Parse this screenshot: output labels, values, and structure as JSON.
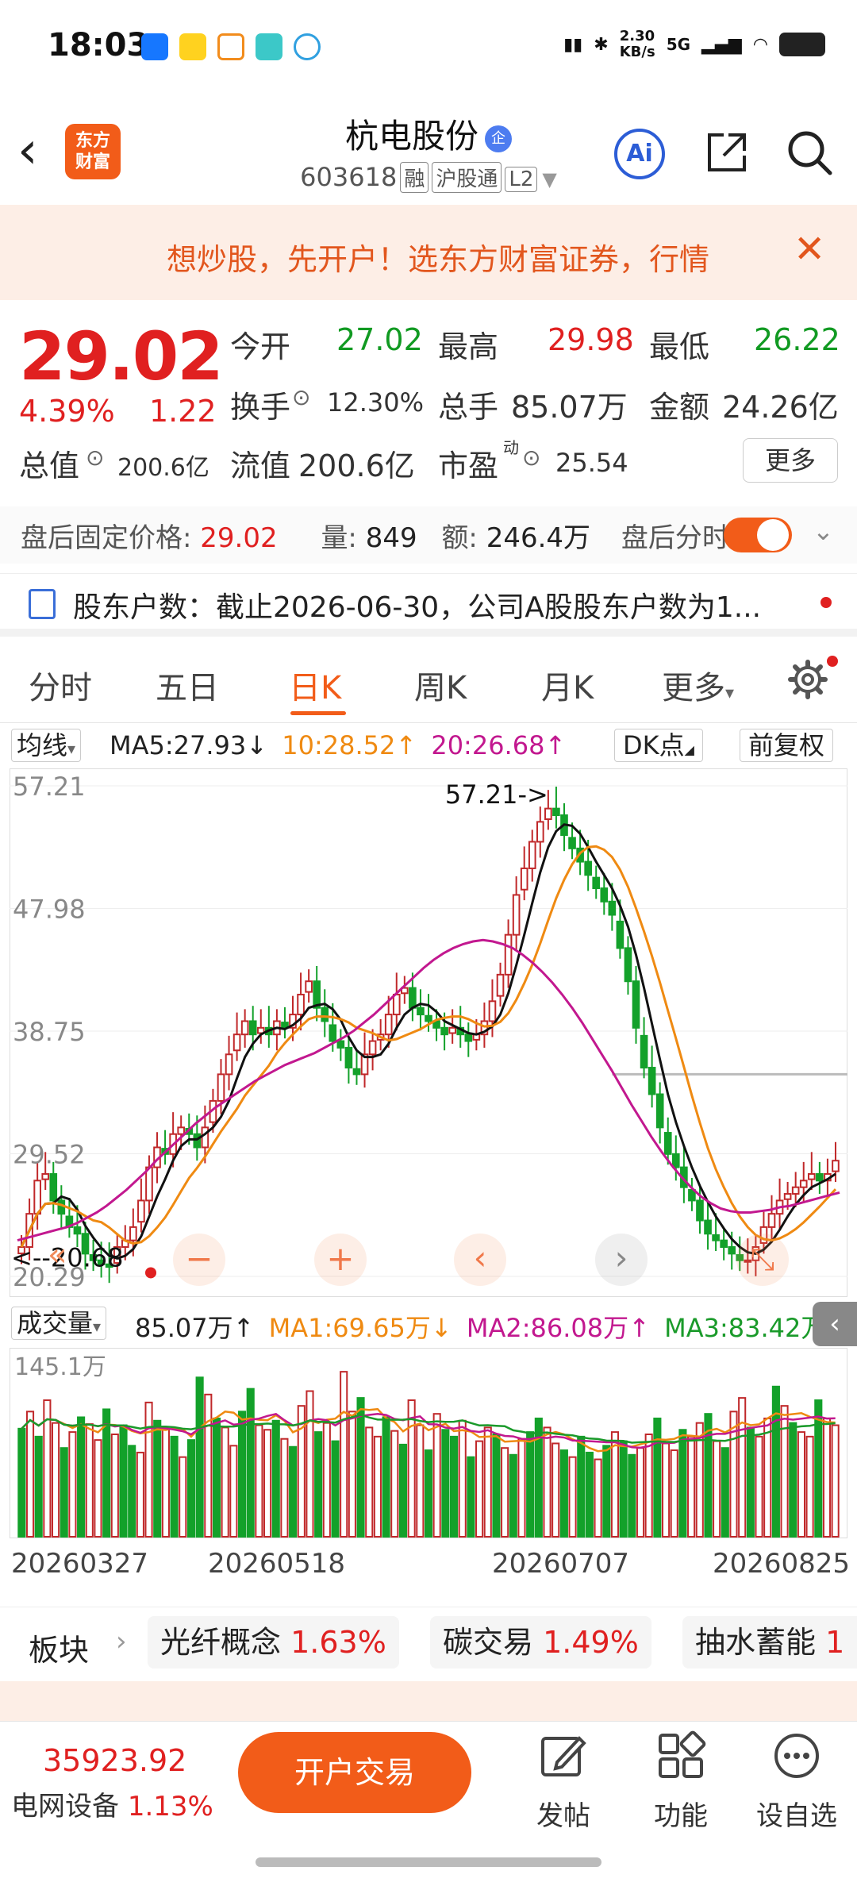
{
  "status_bar": {
    "time": "18:03",
    "app_icons": [
      "alipay-icon",
      "meituan-icon",
      "didi-icon",
      "notes-icon",
      "cloud-icon"
    ],
    "speed_top": "2.30",
    "speed_unit": "KB/s",
    "network": "5G"
  },
  "header": {
    "logo_line1": "东方",
    "logo_line2": "财富",
    "stock_name": "杭电股份",
    "badge": "企",
    "stock_code": "603618",
    "tags": [
      "融",
      "沪股通",
      "L2"
    ],
    "ai_label": "Ai"
  },
  "banner": {
    "text": "想炒股，先开户！选东方财富证券，行情",
    "close": "✕"
  },
  "quote": {
    "price": "29.02",
    "pct": "4.39%",
    "change": "1.22",
    "fields": [
      {
        "label": "今开",
        "value": "27.02",
        "color": "#119a22"
      },
      {
        "label": "最高",
        "value": "29.98",
        "color": "#e02020"
      },
      {
        "label": "最低",
        "value": "26.22",
        "color": "#119a22"
      },
      {
        "label": "换手",
        "value": "12.30%",
        "color": "#333333"
      },
      {
        "label": "总手",
        "value": "85.07万",
        "color": "#333333"
      },
      {
        "label": "金额",
        "value": "24.26亿",
        "color": "#333333"
      },
      {
        "label": "总值",
        "value": "200.6亿",
        "color": "#333333"
      },
      {
        "label": "流值",
        "value": "200.6亿",
        "color": "#333333"
      },
      {
        "label": "市盈",
        "sup": "动",
        "value": "25.54",
        "color": "#333333"
      }
    ],
    "more": "更多"
  },
  "after_hours": {
    "price_label": "盘后固定价格:",
    "price": "29.02",
    "vol_label": "量:",
    "vol": "849",
    "amt_label": "额:",
    "amt": "246.4万",
    "toggle_label": "盘后分时"
  },
  "holders": {
    "text": "股东户数：截止2026-06-30，公司A股股东户数为1..."
  },
  "tabs": [
    "分时",
    "五日",
    "日K",
    "周K",
    "月K",
    "更多"
  ],
  "active_tab": "日K",
  "ma_row": {
    "select": "均线",
    "ma5": "MA5:27.93",
    "ma5_arrow": "↓",
    "ma10": "10:28.52",
    "ma10_arrow": "↑",
    "ma20": "20:26.68",
    "ma20_arrow": "↑",
    "dk": "DK点",
    "fq": "前复权"
  },
  "chart_data": {
    "type": "candlestick",
    "y_ticks": [
      "57.21",
      "47.98",
      "38.75",
      "29.52",
      "20.29"
    ],
    "ylim": [
      20.29,
      57.21
    ],
    "high_annotation": "57.21->",
    "low_annotation": "<--20.68",
    "colors": {
      "up": "#c0282a",
      "down": "#13a12a",
      "ma5": "#111111",
      "ma10": "#ef8a12",
      "ma20": "#c2188f"
    },
    "closes": [
      22.5,
      25,
      27.5,
      28,
      26,
      25,
      24,
      23.5,
      22,
      21.5,
      21.2,
      21,
      22.5,
      23,
      24,
      26,
      28.5,
      30,
      29.5,
      31,
      31.5,
      31,
      30,
      31.5,
      33.5,
      35.5,
      37,
      38.5,
      39.5,
      38.5,
      39,
      38.5,
      39.5,
      39,
      40,
      41.5,
      42.5,
      40.5,
      39.5,
      38,
      37.5,
      36,
      35.5,
      37,
      38,
      38.5,
      40,
      41.5,
      42,
      40.5,
      40,
      39.5,
      39,
      38.5,
      39,
      38.5,
      38,
      38.5,
      39.5,
      41,
      43,
      46,
      49,
      51,
      53,
      54.5,
      55.5,
      55,
      53.5,
      52.5,
      51.5,
      50.5,
      49.5,
      48.5,
      47.5,
      45,
      42.5,
      39,
      36,
      34,
      31.5,
      29.5,
      28.5,
      27,
      26,
      24.5,
      23.5,
      23,
      22.5,
      22,
      21.5,
      21.5,
      22.5,
      24,
      25,
      26,
      26.5,
      27,
      27.5,
      28,
      27.5,
      28,
      29
    ],
    "ma20_values": [
      23,
      23.2,
      23.4,
      23.6,
      23.8,
      24,
      24.3,
      24.7,
      25.1,
      25.6,
      26.2,
      26.8,
      27.5,
      28.2,
      29,
      29.7,
      30.4,
      31.1,
      31.8,
      32.4,
      33,
      33.5,
      34,
      34.5,
      35,
      35.4,
      35.8,
      36.2,
      36.5,
      36.8,
      37.1,
      37.5,
      37.9,
      38.3,
      38.8,
      39.4,
      40,
      40.7,
      41.4,
      42.1,
      42.8,
      43.5,
      44.1,
      44.6,
      45,
      45.3,
      45.5,
      45.6,
      45.5,
      45.3,
      45,
      44.5,
      43.9,
      43.2,
      42.4,
      41.5,
      40.5,
      39.4,
      38.2,
      37,
      35.8,
      34.5,
      33.2,
      32,
      30.8,
      29.7,
      28.7,
      27.8,
      27,
      26.3,
      25.8,
      25.4,
      25.2,
      25.1,
      25.1,
      25.2,
      25.3,
      25.5,
      25.6,
      25.8,
      26,
      26.2,
      26.4,
      26.6
    ],
    "cutoff_line": 35.5
  },
  "volume_row": {
    "select": "成交量",
    "vol": "85.07万",
    "vol_arrow": "↑",
    "ma1": "MA1:69.65万",
    "ma1_arrow": "↓",
    "ma2": "MA2:86.08万",
    "ma2_arrow": "↑",
    "ma3": "MA3:83.42万",
    "ma3_arrow": "↑",
    "y_max": "145.1万",
    "collapse": "‹"
  },
  "volume_data": {
    "max": 145.1,
    "values": [
      95,
      110,
      88,
      120,
      100,
      78,
      92,
      105,
      99,
      85,
      112,
      90,
      98,
      80,
      74,
      118,
      102,
      95,
      88,
      70,
      85,
      140,
      125,
      104,
      96,
      80,
      110,
      130,
      98,
      94,
      102,
      86,
      79,
      115,
      128,
      92,
      100,
      84,
      145,
      110,
      122,
      96,
      88,
      105,
      93,
      81,
      120,
      98,
      76,
      108,
      94,
      88,
      102,
      70,
      84,
      96,
      90,
      78,
      72,
      86,
      92,
      104,
      96,
      82,
      76,
      70,
      88,
      74,
      68,
      80,
      92,
      84,
      72,
      78,
      90,
      104,
      82,
      76,
      94,
      88,
      100,
      108,
      84,
      78,
      110,
      122,
      96,
      88,
      104,
      132,
      115,
      100,
      92,
      88,
      120,
      104,
      98
    ],
    "ups_pattern": [
      0,
      1,
      0,
      1,
      1,
      0,
      1,
      0,
      1,
      1,
      0,
      1,
      0,
      0,
      1,
      1,
      0,
      1,
      0,
      1,
      0,
      0,
      1,
      0,
      1,
      1,
      0,
      0,
      1,
      1,
      0,
      1,
      0,
      1,
      1,
      0,
      1,
      0,
      1,
      1,
      0,
      1,
      1,
      0,
      1,
      0,
      1,
      1,
      0,
      1,
      0,
      0,
      1,
      0,
      1,
      1,
      0,
      1,
      0,
      1,
      0,
      0,
      1,
      1,
      0,
      1,
      0,
      0,
      1,
      0,
      1,
      0,
      0,
      1,
      1,
      0,
      1,
      1,
      0,
      1,
      1,
      0,
      1,
      0,
      1,
      1,
      0,
      1,
      1,
      0,
      1,
      0,
      1,
      1,
      0,
      1,
      1
    ],
    "ma_colors": [
      "#ef8a12",
      "#c2188f",
      "#1a9a2a"
    ]
  },
  "dates": [
    "20260327",
    "20260518",
    "20260707",
    "20260825"
  ],
  "chart_controls": [
    "«",
    "−",
    "+",
    "‹",
    "›",
    "⤡"
  ],
  "sectors": {
    "label": "板块",
    "items": [
      {
        "name": "光纤概念",
        "pct": "1.63%"
      },
      {
        "name": "碳交易",
        "pct": "1.49%"
      },
      {
        "name": "抽水蓄能",
        "pct": "1"
      }
    ]
  },
  "bottom": {
    "index_value": "35923.92",
    "index_name": "电网设备",
    "index_pct": "1.13%",
    "open_button": "开户交易",
    "actions": [
      "发帖",
      "功能",
      "设自选"
    ]
  }
}
